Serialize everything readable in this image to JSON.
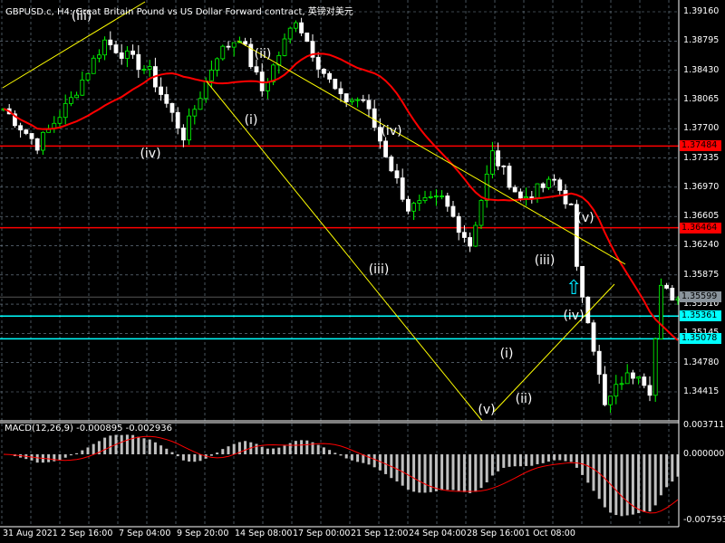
{
  "title": "GBPUSD.c, H4:  Great Britain Pound vs US Dollar Forward contract, 英镑对美元",
  "colors": {
    "bull": "#00ff00",
    "bear": "#ffffff",
    "ma": "#ff0000",
    "hline_red": "#ff0000",
    "hline_cyan": "#00ffff",
    "trend": "#ffff00",
    "grid": "#7a8a9a",
    "macd_hist": "#c0c0c0",
    "macd_signal": "#ff0000"
  },
  "price_axis": [
    "1.39160",
    "1.38795",
    "1.38430",
    "1.38065",
    "1.37700",
    "1.37335",
    "1.36970",
    "1.36605",
    "1.36240",
    "1.35875",
    "1.35510",
    "1.35145",
    "1.34780",
    "1.34415"
  ],
  "price_tags": [
    {
      "label": "1.37484",
      "value": 1.37484,
      "color": "#ff0000"
    },
    {
      "label": "1.36464",
      "value": 1.36464,
      "color": "#ff0000"
    },
    {
      "label": "1.35599",
      "value": 1.35599,
      "color": "#8a949c"
    },
    {
      "label": "1.35361",
      "value": 1.35361,
      "color": "#00ffff"
    },
    {
      "label": "1.35078",
      "value": 1.35078,
      "color": "#00ffff"
    }
  ],
  "macd": {
    "label": "MACD(12,26,9) -0.000895 -0.002936",
    "axis": [
      "0.003711",
      "0.000000",
      "-0.007593"
    ]
  },
  "time_axis": [
    "31 Aug 2021",
    "2 Sep 16:00",
    "7 Sep 04:00",
    "9 Sep 20:00",
    "14 Sep 08:00",
    "17 Sep 00:00",
    "21 Sep 12:00",
    "24 Sep 04:00",
    "28 Sep 16:00",
    "1 Oct 08:00"
  ],
  "wave_labels": [
    "(iii)",
    "(iv)",
    "(i)",
    "(ii)",
    "(iii)",
    "(iv)",
    "(v)",
    "(i)",
    "(ii)",
    "(iii)",
    "(iv)",
    "(v)"
  ],
  "chart_data": {
    "type": "candlestick",
    "symbol": "GBPUSD.c",
    "timeframe": "H4",
    "ylim": [
      1.3415,
      1.3935
    ],
    "close_waypoints": [
      [
        0,
        1.37951
      ],
      [
        6,
        1.37499
      ],
      [
        12,
        1.38064
      ],
      [
        18,
        1.38798
      ],
      [
        26,
        1.38403
      ],
      [
        32,
        1.37612
      ],
      [
        38,
        1.38629
      ],
      [
        42,
        1.38855
      ],
      [
        46,
        1.38177
      ],
      [
        52,
        1.39081
      ],
      [
        56,
        1.38516
      ],
      [
        60,
        1.38064
      ],
      [
        64,
        1.38064
      ],
      [
        68,
        1.37386
      ],
      [
        72,
        1.36708
      ],
      [
        78,
        1.36821
      ],
      [
        83,
        1.36257
      ],
      [
        87,
        1.37386
      ],
      [
        92,
        1.36821
      ],
      [
        98,
        1.37047
      ],
      [
        101,
        1.36708
      ],
      [
        102,
        1.35918
      ],
      [
        104,
        1.35353
      ],
      [
        107,
        1.34223
      ],
      [
        110,
        1.34562
      ],
      [
        113,
        1.34675
      ],
      [
        115,
        1.34449
      ],
      [
        117,
        1.35692
      ],
      [
        120,
        1.35579
      ]
    ],
    "ma_period": 20,
    "macd_params": [
      12,
      26,
      9
    ]
  }
}
